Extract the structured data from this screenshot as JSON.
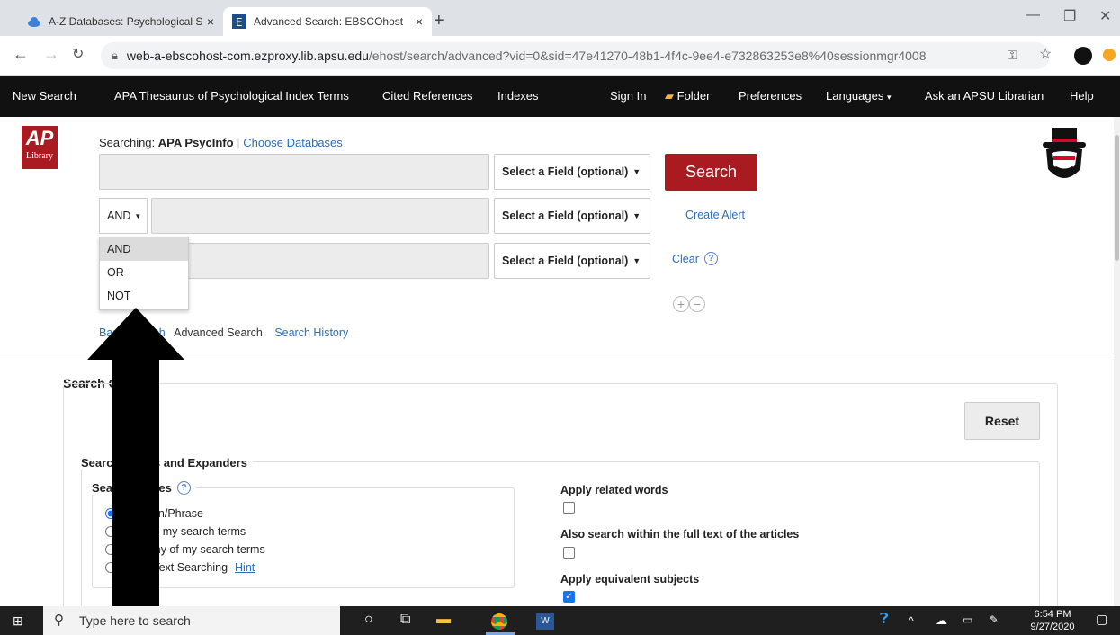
{
  "browser": {
    "tabs": [
      {
        "title": "A-Z Databases: Psychological Sci",
        "close": "×"
      },
      {
        "title": "Advanced Search: EBSCOhost",
        "close": "×"
      }
    ],
    "new_tab": "+",
    "url_host": "web-a-ebscohost-com.ezproxy.lib.apsu.edu",
    "url_path": "/ehost/search/advanced?vid=0&sid=47e41270-48b1-4f4c-9ee4-e732863253e8%40sessionmgr4008"
  },
  "topnav": {
    "new_search": "New Search",
    "thesaurus": "APA Thesaurus of Psychological Index Terms",
    "cited": "Cited References",
    "indexes": "Indexes",
    "signin": "Sign In",
    "folder": "Folder",
    "preferences": "Preferences",
    "languages": "Languages",
    "ask": "Ask an APSU Librarian",
    "help": "Help"
  },
  "logo_text": "Library",
  "searching": {
    "label": "Searching:",
    "db": "APA PsycInfo",
    "choose": "Choose Databases"
  },
  "field_select": "Select a Field (optional)",
  "search_button": "Search",
  "bool_value": "AND",
  "bool_menu": [
    "AND",
    "OR",
    "NOT"
  ],
  "create_alert": "Create Alert",
  "clear": "Clear",
  "mode_links": {
    "basic": "Basic Search",
    "advanced": "Advanced Search",
    "history": "Search History"
  },
  "options_heading": "Search Options",
  "reset": "Reset",
  "modes_heading": "Search Modes and Expanders",
  "search_modes_label": "Search modes",
  "modes": [
    "Boolean/Phrase",
    "Find all my search terms",
    "Find any of my search terms",
    "SmartText Searching"
  ],
  "hint": "Hint",
  "expanders": [
    "Apply related words",
    "Also search within the full text of the articles",
    "Apply equivalent subjects"
  ],
  "taskbar": {
    "search_placeholder": "Type here to search",
    "time": "6:54 PM",
    "date": "9/27/2020"
  },
  "colors": {
    "search_button": "#a91b21",
    "nav_bg": "#111111",
    "link": "#2a6ebb"
  }
}
